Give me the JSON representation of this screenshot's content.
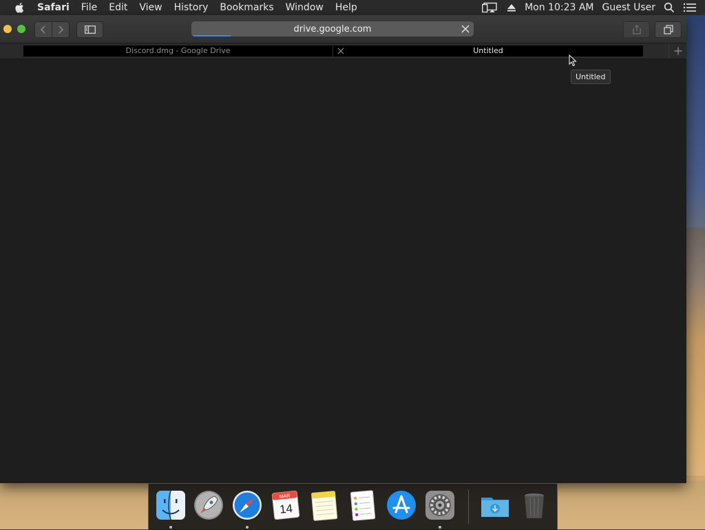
{
  "menubar": {
    "app_name": "Safari",
    "menus": [
      "File",
      "Edit",
      "View",
      "History",
      "Bookmarks",
      "Window",
      "Help"
    ],
    "clock": "Mon 10:23 AM",
    "user": "Guest User"
  },
  "toolbar": {
    "url": "drive.google.com",
    "page_load_progress": 0.14
  },
  "tabs": [
    {
      "title": "Discord.dmg - Google Drive",
      "active": false
    },
    {
      "title": "Untitled",
      "active": true
    }
  ],
  "tooltip": "Untitled",
  "calendar": {
    "month": "MAR",
    "day": "14"
  },
  "dock": {
    "items": [
      "finder-icon",
      "launchpad-icon",
      "safari-icon",
      "calendar-icon",
      "notes-icon",
      "reminders-icon",
      "app-store-icon",
      "system-preferences-icon",
      "downloads-folder-icon",
      "trash-icon"
    ],
    "running": [
      "finder-icon",
      "safari-icon",
      "system-preferences-icon"
    ]
  },
  "colors": {
    "accent": "#2f8bf5",
    "window_bg": "#1e1e1e",
    "menubar_bg": "#2b2b2b"
  }
}
